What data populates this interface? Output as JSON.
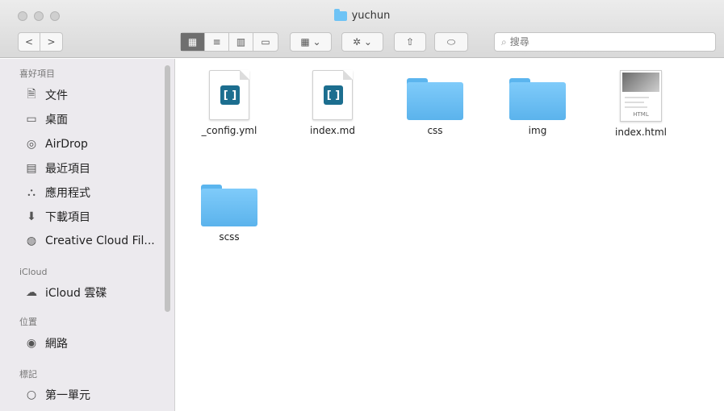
{
  "window": {
    "title": "yuchun"
  },
  "toolbar": {
    "back_label": "<",
    "forward_label": ">",
    "view_icons": "▦",
    "view_list": "≡",
    "view_columns": "▥",
    "view_gallery": "▭",
    "group_label": "▦ ⌄",
    "action_label": "✲ ⌄",
    "share_label": "⇧",
    "tag_label": "⬭",
    "search_placeholder": "搜尋",
    "search_glyph": "⌕"
  },
  "sidebar": {
    "favorites_label": "喜好項目",
    "favorites": [
      {
        "label": "文件",
        "icon": "document-icon",
        "glyph": "🗎"
      },
      {
        "label": "桌面",
        "icon": "desktop-icon",
        "glyph": "▭"
      },
      {
        "label": "AirDrop",
        "icon": "airdrop-icon",
        "glyph": "◎"
      },
      {
        "label": "最近項目",
        "icon": "recents-icon",
        "glyph": "▤"
      },
      {
        "label": "應用程式",
        "icon": "applications-icon",
        "glyph": "⛬"
      },
      {
        "label": "下載項目",
        "icon": "downloads-icon",
        "glyph": "⬇"
      },
      {
        "label": "Creative Cloud Fil...",
        "icon": "creative-cloud-icon",
        "glyph": "◍"
      }
    ],
    "icloud_label": "iCloud",
    "icloud": [
      {
        "label": "iCloud 雲碟",
        "icon": "cloud-icon",
        "glyph": "☁"
      }
    ],
    "locations_label": "位置",
    "locations": [
      {
        "label": "網路",
        "icon": "network-icon",
        "glyph": "◉"
      }
    ],
    "tags_label": "標記",
    "tags": [
      {
        "label": "第一單元",
        "icon": "tag-dot-icon",
        "glyph": "○"
      }
    ]
  },
  "files": [
    {
      "name": "_config.yml",
      "kind": "brackets-doc"
    },
    {
      "name": "index.md",
      "kind": "brackets-doc"
    },
    {
      "name": "css",
      "kind": "folder"
    },
    {
      "name": "img",
      "kind": "folder"
    },
    {
      "name": "index.html",
      "kind": "html",
      "thumb_label": "HTML"
    },
    {
      "name": "scss",
      "kind": "folder"
    }
  ],
  "colors": {
    "folder": "#6ec3f5",
    "brackets": "#1c6e8f",
    "sidebar_bg": "#eceaee"
  }
}
